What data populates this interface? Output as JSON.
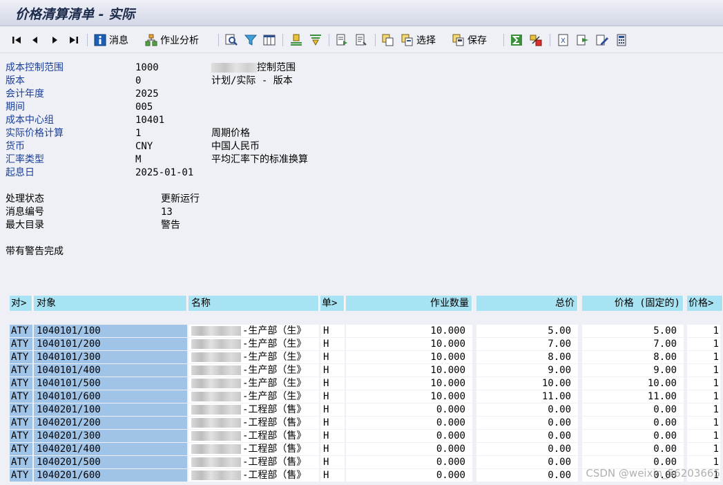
{
  "window": {
    "title": "价格清算清单 - 实际"
  },
  "toolbar": {
    "messages_label": "消息",
    "activity_analysis_label": "作业分析",
    "select_label": "选择",
    "save_label": "保存"
  },
  "header": {
    "rows": [
      {
        "label": "成本控制范围",
        "value": "1000",
        "desc": "控制范围"
      },
      {
        "label": "版本",
        "value": "0",
        "desc": "计划/实际 - 版本"
      },
      {
        "label": "会计年度",
        "value": "2025",
        "desc": ""
      },
      {
        "label": "期间",
        "value": "005",
        "desc": ""
      },
      {
        "label": "成本中心组",
        "value": "10401",
        "desc": ""
      },
      {
        "label": "实际价格计算",
        "value": "1",
        "desc": "周期价格"
      },
      {
        "label": "货币",
        "value": "CNY",
        "desc": "中国人民币"
      },
      {
        "label": "汇率类型",
        "value": "M",
        "desc": "平均汇率下的标准换算"
      },
      {
        "label": "起息日",
        "value": "2025-01-01",
        "desc": ""
      }
    ]
  },
  "status": {
    "rows": [
      {
        "label": "处理状态",
        "value": "更新运行"
      },
      {
        "label": "消息编号",
        "value": "13"
      },
      {
        "label": "最大目录",
        "value": "警告"
      }
    ],
    "completion": "带有警告完成"
  },
  "table": {
    "columns": [
      "对>",
      "对象",
      "名称",
      "单>",
      "作业数量",
      "总价",
      "价格 (固定的)",
      "价格>"
    ],
    "rows": [
      {
        "type": "ATY",
        "object": "1040101/100",
        "name": "-生产部（生》",
        "unit": "H",
        "qty": "10.000",
        "total": "5.00",
        "fixed": "5.00",
        "price": "1"
      },
      {
        "type": "ATY",
        "object": "1040101/200",
        "name": "-生产部（生》",
        "unit": "H",
        "qty": "10.000",
        "total": "7.00",
        "fixed": "7.00",
        "price": "1"
      },
      {
        "type": "ATY",
        "object": "1040101/300",
        "name": "-生产部（生》",
        "unit": "H",
        "qty": "10.000",
        "total": "8.00",
        "fixed": "8.00",
        "price": "1"
      },
      {
        "type": "ATY",
        "object": "1040101/400",
        "name": "-生产部（生》",
        "unit": "H",
        "qty": "10.000",
        "total": "9.00",
        "fixed": "9.00",
        "price": "1"
      },
      {
        "type": "ATY",
        "object": "1040101/500",
        "name": "-生产部（生》",
        "unit": "H",
        "qty": "10.000",
        "total": "10.00",
        "fixed": "10.00",
        "price": "1"
      },
      {
        "type": "ATY",
        "object": "1040101/600",
        "name": "-生产部（生》",
        "unit": "H",
        "qty": "10.000",
        "total": "11.00",
        "fixed": "11.00",
        "price": "1"
      },
      {
        "type": "ATY",
        "object": "1040201/100",
        "name": "-工程部（售》",
        "unit": "H",
        "qty": "0.000",
        "total": "0.00",
        "fixed": "0.00",
        "price": "1"
      },
      {
        "type": "ATY",
        "object": "1040201/200",
        "name": "-工程部（售》",
        "unit": "H",
        "qty": "0.000",
        "total": "0.00",
        "fixed": "0.00",
        "price": "1"
      },
      {
        "type": "ATY",
        "object": "1040201/300",
        "name": "-工程部（售》",
        "unit": "H",
        "qty": "0.000",
        "total": "0.00",
        "fixed": "0.00",
        "price": "1"
      },
      {
        "type": "ATY",
        "object": "1040201/400",
        "name": "-工程部（售》",
        "unit": "H",
        "qty": "0.000",
        "total": "0.00",
        "fixed": "0.00",
        "price": "1"
      },
      {
        "type": "ATY",
        "object": "1040201/500",
        "name": "-工程部（售》",
        "unit": "H",
        "qty": "0.000",
        "total": "0.00",
        "fixed": "0.00",
        "price": "1"
      },
      {
        "type": "ATY",
        "object": "1040201/600",
        "name": "-工程部（售》",
        "unit": "H",
        "qty": "0.000",
        "total": "0.00",
        "fixed": "0.00",
        "price": "1"
      }
    ]
  },
  "watermark": "CSDN @weixin_56203665"
}
